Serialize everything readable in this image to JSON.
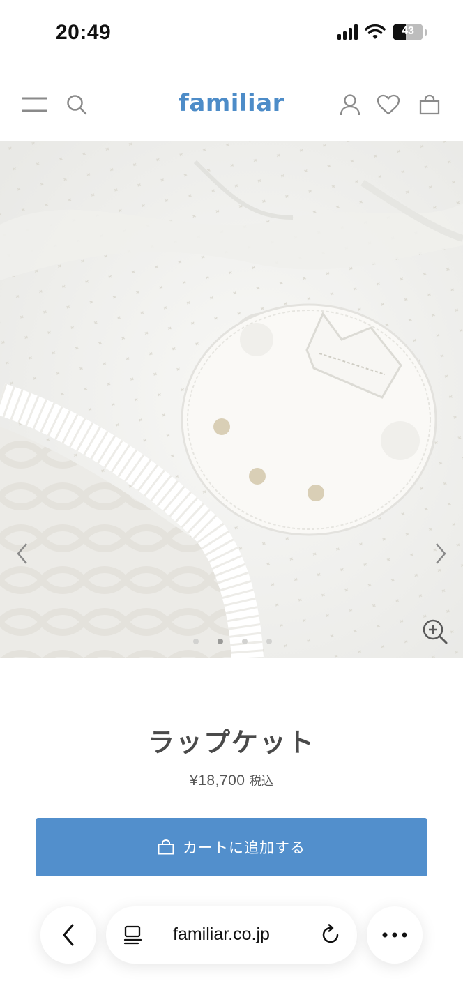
{
  "status_bar": {
    "time": "20:49",
    "battery": "43",
    "battery_level": 0.43
  },
  "header": {
    "logo": "familiar",
    "icons": [
      "menu-icon",
      "search-icon",
      "account-icon",
      "heart-icon",
      "bag-icon"
    ]
  },
  "gallery": {
    "image_count": 4,
    "active_index": 1
  },
  "product": {
    "name": "ラップケット",
    "price": "¥18,700",
    "tax_label": "税込",
    "add_to_cart_label": "カートに追加する"
  },
  "browser": {
    "url": "familiar.co.jp"
  },
  "colors": {
    "brand": "#4d8cc8",
    "cart_button": "#528fcc"
  }
}
